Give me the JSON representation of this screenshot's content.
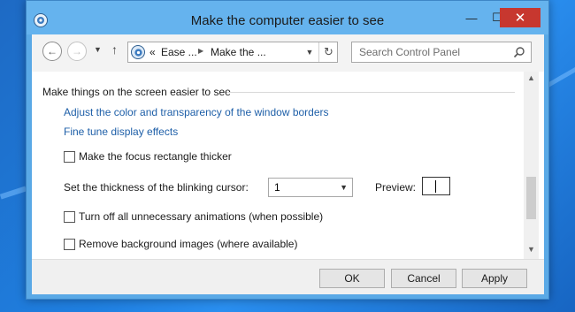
{
  "window": {
    "title": "Make the computer easier to see",
    "controls": {
      "minimize": "—",
      "maximize": "☐",
      "close": "✕"
    }
  },
  "navigation": {
    "back_icon": "back-arrow-icon",
    "forward_icon": "forward-arrow-icon",
    "up_icon": "up-arrow-icon",
    "address": {
      "prefix": "«",
      "crumbs": [
        "Ease ...",
        "Make the ..."
      ]
    },
    "search": {
      "placeholder": "Search Control Panel"
    }
  },
  "content": {
    "section_title": "Make things on the screen easier to see",
    "links": [
      "Adjust the color and transparency of the window borders",
      "Fine tune display effects"
    ],
    "focus_rect": {
      "label": "Make the focus rectangle thicker",
      "checked": false
    },
    "cursor_thickness": {
      "label": "Set the thickness of the blinking cursor:",
      "value": "1"
    },
    "preview": {
      "label": "Preview:"
    },
    "animations": {
      "label": "Turn off all unnecessary animations (when possible)",
      "checked": false
    },
    "backgrounds": {
      "label": "Remove background images (where available)",
      "checked": false
    }
  },
  "footer": {
    "ok": "OK",
    "cancel": "Cancel",
    "apply": "Apply"
  },
  "colors": {
    "link": "#1e5fa8",
    "titlebar": "#65b3ee",
    "close_button": "#c7372f"
  }
}
